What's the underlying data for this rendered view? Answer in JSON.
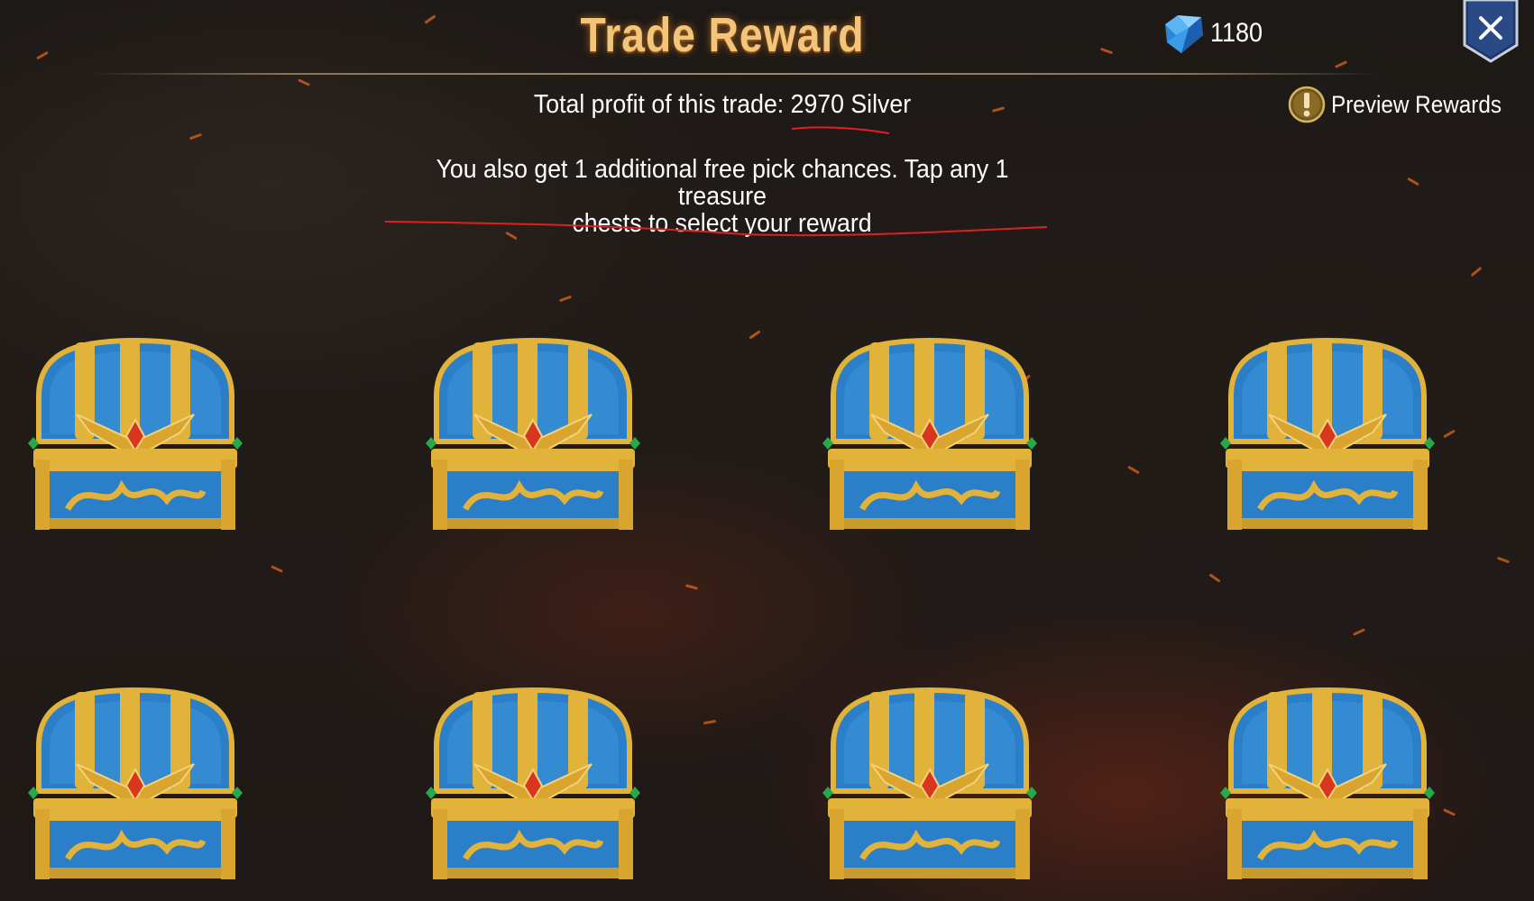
{
  "header": {
    "title": "Trade Reward",
    "currency_icon": "diamond-gem-icon",
    "currency_value": "1180",
    "close_icon": "close-x-icon"
  },
  "summary": {
    "profit_text": "Total profit of this trade: 2970 Silver",
    "preview_label": "Preview Rewards",
    "preview_icon": "exclamation-info-icon",
    "info_line_1": "You also get 1 additional free pick chances. Tap any 1 treasure",
    "info_line_2": "chests to select your reward"
  },
  "annotations": {
    "color": "#e02020"
  },
  "chests": {
    "count": 8,
    "icon": "treasure-chest-icon",
    "colors": {
      "body": "#2b7fc8",
      "trim": "#e2b33a",
      "gem": "#d8361e"
    }
  },
  "theme": {
    "title_color": "#f2c57a",
    "background": "#1e1816",
    "ember": "#e0641e"
  }
}
